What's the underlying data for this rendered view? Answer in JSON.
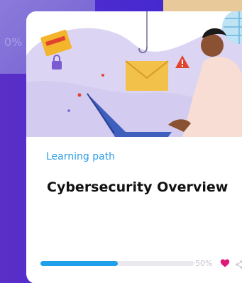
{
  "background_card": {
    "progress_text": "0%"
  },
  "course_card": {
    "type_label": "Learning path",
    "title": "Cybersecurity Overview",
    "progress": 0.5,
    "progress_text": "50%",
    "icons": [
      "heart-icon",
      "share-icon"
    ]
  },
  "colors": {
    "background": "#4c2bd0",
    "accent_blue": "#1ea0ea",
    "type_label": "#2e9de6",
    "heart": "#e0177a"
  }
}
